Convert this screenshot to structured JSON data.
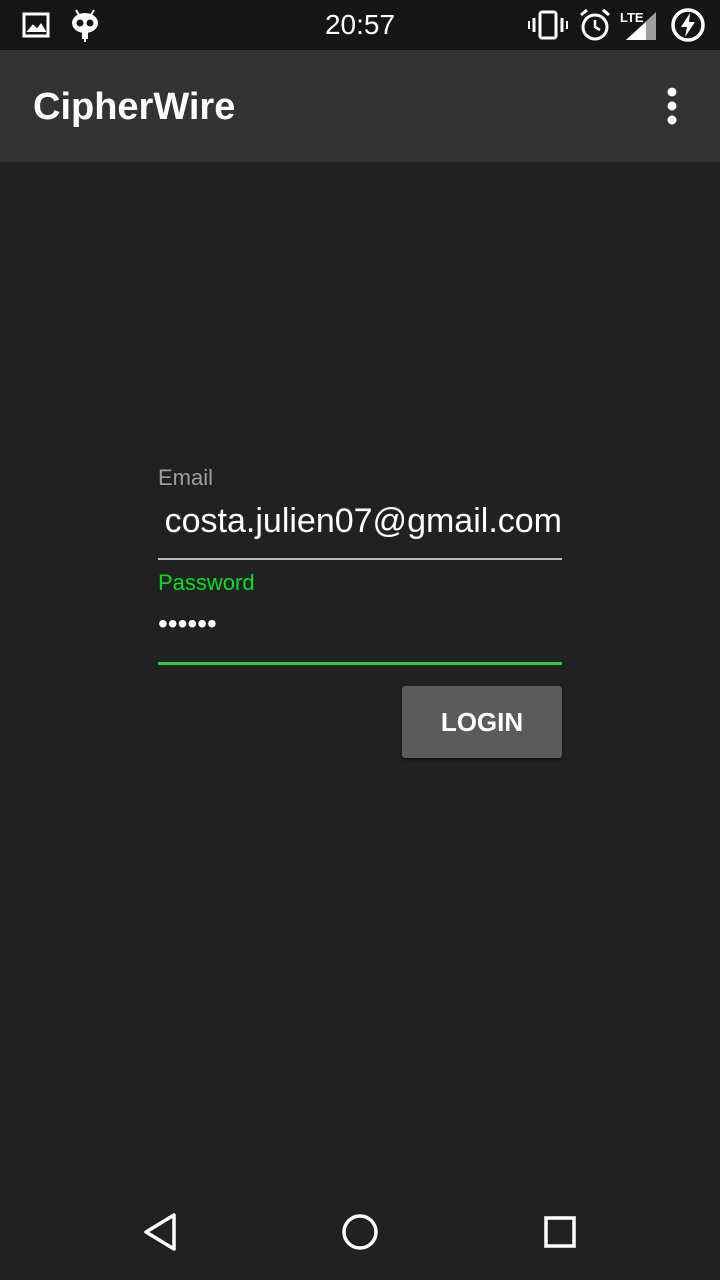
{
  "status_bar": {
    "time": "20:57",
    "network_label": "LTE",
    "left_icons": [
      "image-icon",
      "cyanogen-mascot-icon"
    ],
    "right_icons": [
      "vibrate-icon",
      "alarm-icon",
      "signal-icon",
      "battery-charging-icon"
    ]
  },
  "app_bar": {
    "title": "CipherWire",
    "overflow_icon": "more-vert-icon"
  },
  "form": {
    "email_label": "Email",
    "email_value": "costa.julien07@gmail.com",
    "password_label": "Password",
    "password_value": "••••••",
    "login_label": "LOGIN"
  },
  "nav_bar": {
    "buttons": [
      "back-icon",
      "home-icon",
      "recents-icon"
    ]
  },
  "colors": {
    "background": "#212121",
    "app_bar": "#333333",
    "status_bar": "#151515",
    "accent": "#00e01a",
    "button": "#5b5b5b"
  }
}
